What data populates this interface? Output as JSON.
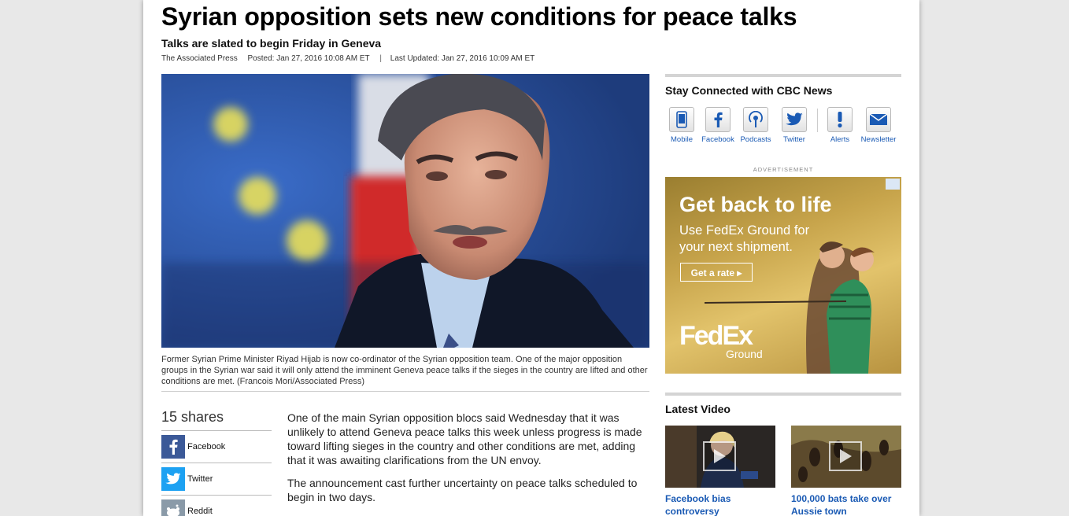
{
  "article": {
    "headline": "Syrian opposition sets new conditions for peace talks",
    "subheadline": "Talks are slated to begin Friday in Geneva",
    "source": "The Associated Press",
    "posted": "Posted: Jan 27, 2016 10:08 AM ET",
    "updated": "Last Updated: Jan 27, 2016 10:09 AM ET",
    "photo_caption": "Former Syrian Prime Minister Riyad Hijab is now co-ordinator of the Syrian opposition team. One of the major opposition groups in the Syrian war said it will only attend the imminent Geneva peace talks if the sieges in the country are lifted and other conditions are met. (Francois Mori/Associated Press)",
    "paragraphs": [
      "One of the main Syrian opposition blocs said Wednesday that it was unlikely to attend Geneva peace talks this week unless progress is made toward lifting sieges in the country and other conditions are met, adding that it was awaiting clarifications from the UN envoy.",
      "The announcement cast further uncertainty on peace talks scheduled to begin in two days."
    ]
  },
  "share": {
    "count": "15 shares",
    "items": [
      {
        "label": "Facebook",
        "color": "#3b5998",
        "icon": "facebook-icon"
      },
      {
        "label": "Twitter",
        "color": "#1da1f2",
        "icon": "twitter-icon"
      },
      {
        "label": "Reddit",
        "color": "#8a9aa8",
        "icon": "reddit-icon"
      }
    ]
  },
  "sidebar": {
    "stay_connected": "Stay Connected with CBC News",
    "social": [
      {
        "label": "Mobile",
        "icon": "mobile-icon"
      },
      {
        "label": "Facebook",
        "icon": "facebook-icon"
      },
      {
        "label": "Podcasts",
        "icon": "podcast-icon"
      },
      {
        "label": "Twitter",
        "icon": "twitter-icon"
      },
      {
        "label": "Alerts",
        "icon": "alert-icon"
      },
      {
        "label": "Newsletter",
        "icon": "newsletter-icon"
      }
    ],
    "advertisement_label": "ADVERTISEMENT",
    "ad": {
      "headline": "Get back to life",
      "subtext": "Use FedEx Ground for your next shipment.",
      "button": "Get a rate ▸",
      "logo_main": "FedEx",
      "logo_sub": "Ground"
    },
    "latest_video": "Latest Video",
    "videos": [
      {
        "title": "Facebook bias controversy"
      },
      {
        "title": "100,000 bats take over Aussie town"
      }
    ]
  },
  "colors": {
    "link": "#1a5ab4",
    "facebook": "#3b5998",
    "twitter": "#1da1f2"
  }
}
